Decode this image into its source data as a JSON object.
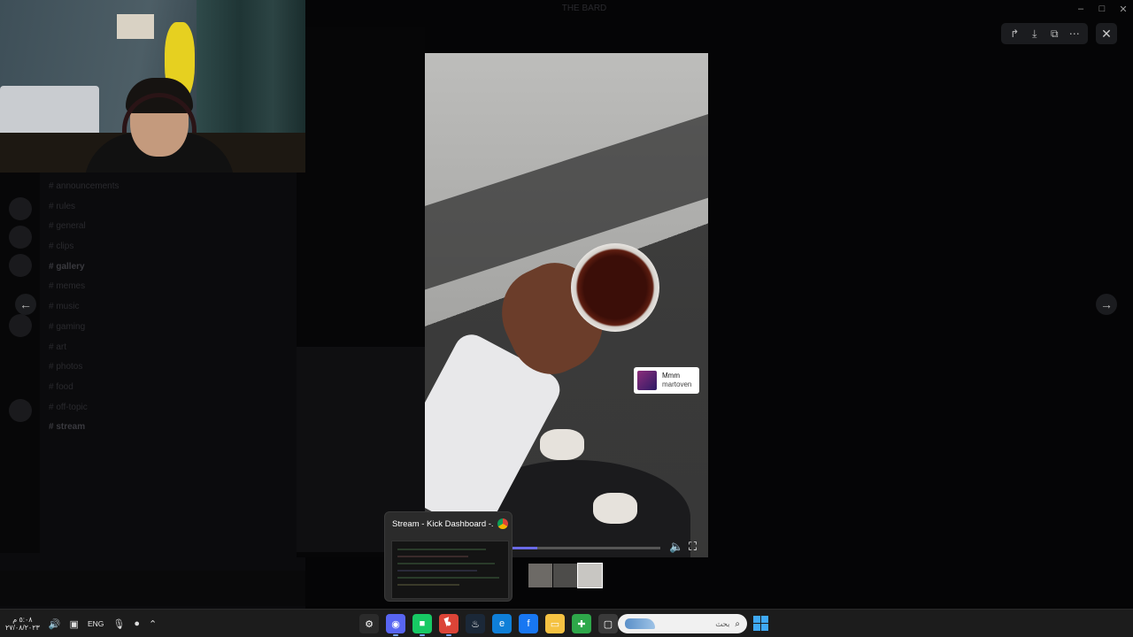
{
  "background_app": {
    "title": "THE BARD",
    "channels": [
      {
        "label": "announcements",
        "strong": false
      },
      {
        "label": "rules",
        "strong": false
      },
      {
        "label": "general",
        "strong": false
      },
      {
        "label": "clips",
        "strong": false
      },
      {
        "label": "gallery",
        "strong": true
      },
      {
        "label": "memes",
        "strong": false
      },
      {
        "label": "music",
        "strong": false
      },
      {
        "label": "gaming",
        "strong": false
      },
      {
        "label": "art",
        "strong": false
      },
      {
        "label": "photos",
        "strong": false
      },
      {
        "label": "food",
        "strong": false
      },
      {
        "label": "off-topic",
        "strong": false
      },
      {
        "label": "stream",
        "strong": true
      }
    ]
  },
  "viewer": {
    "prev_icon": "arrow-left-icon",
    "next_icon": "arrow-right-icon",
    "toolbar": [
      "forward-icon",
      "download-icon",
      "open-external-icon",
      "more-icon"
    ],
    "close_icon": "close-icon",
    "tag": {
      "name": "Mmm",
      "user": "martoven"
    },
    "progress": 0.18,
    "thumbnail_count": 3
  },
  "taskbar_preview": {
    "title": "Stream - Kick Dashboard -...",
    "app_icon": "chrome-icon"
  },
  "taskbar": {
    "clock_time": "٥:٠٨ م",
    "clock_date": "٢٧/٠٨/٢٠٢٣",
    "language": "ENG",
    "search_placeholder": "بحث",
    "apps": [
      {
        "name": "settings-app",
        "glyph": "⚙",
        "color": "#2b2b2b",
        "active": false
      },
      {
        "name": "discord-app",
        "glyph": "◉",
        "color": "#5865f2",
        "active": true
      },
      {
        "name": "kick-app",
        "glyph": "■",
        "color": "#17c964",
        "active": true
      },
      {
        "name": "chrome-app",
        "glyph": "●",
        "color": "#db4437",
        "active": true
      },
      {
        "name": "steam-app",
        "glyph": "♨",
        "color": "#1b2838",
        "active": false
      },
      {
        "name": "edge-app",
        "glyph": "e",
        "color": "#0f7fd8",
        "active": false
      },
      {
        "name": "facebook-app",
        "glyph": "f",
        "color": "#1877f2",
        "active": false
      },
      {
        "name": "explorer-app",
        "glyph": "▭",
        "color": "#f5c242",
        "active": false
      },
      {
        "name": "xbox-app",
        "glyph": "✚",
        "color": "#2ea84a",
        "active": false
      },
      {
        "name": "taskview-app",
        "glyph": "▢",
        "color": "#3a3a3a",
        "active": false
      }
    ]
  }
}
